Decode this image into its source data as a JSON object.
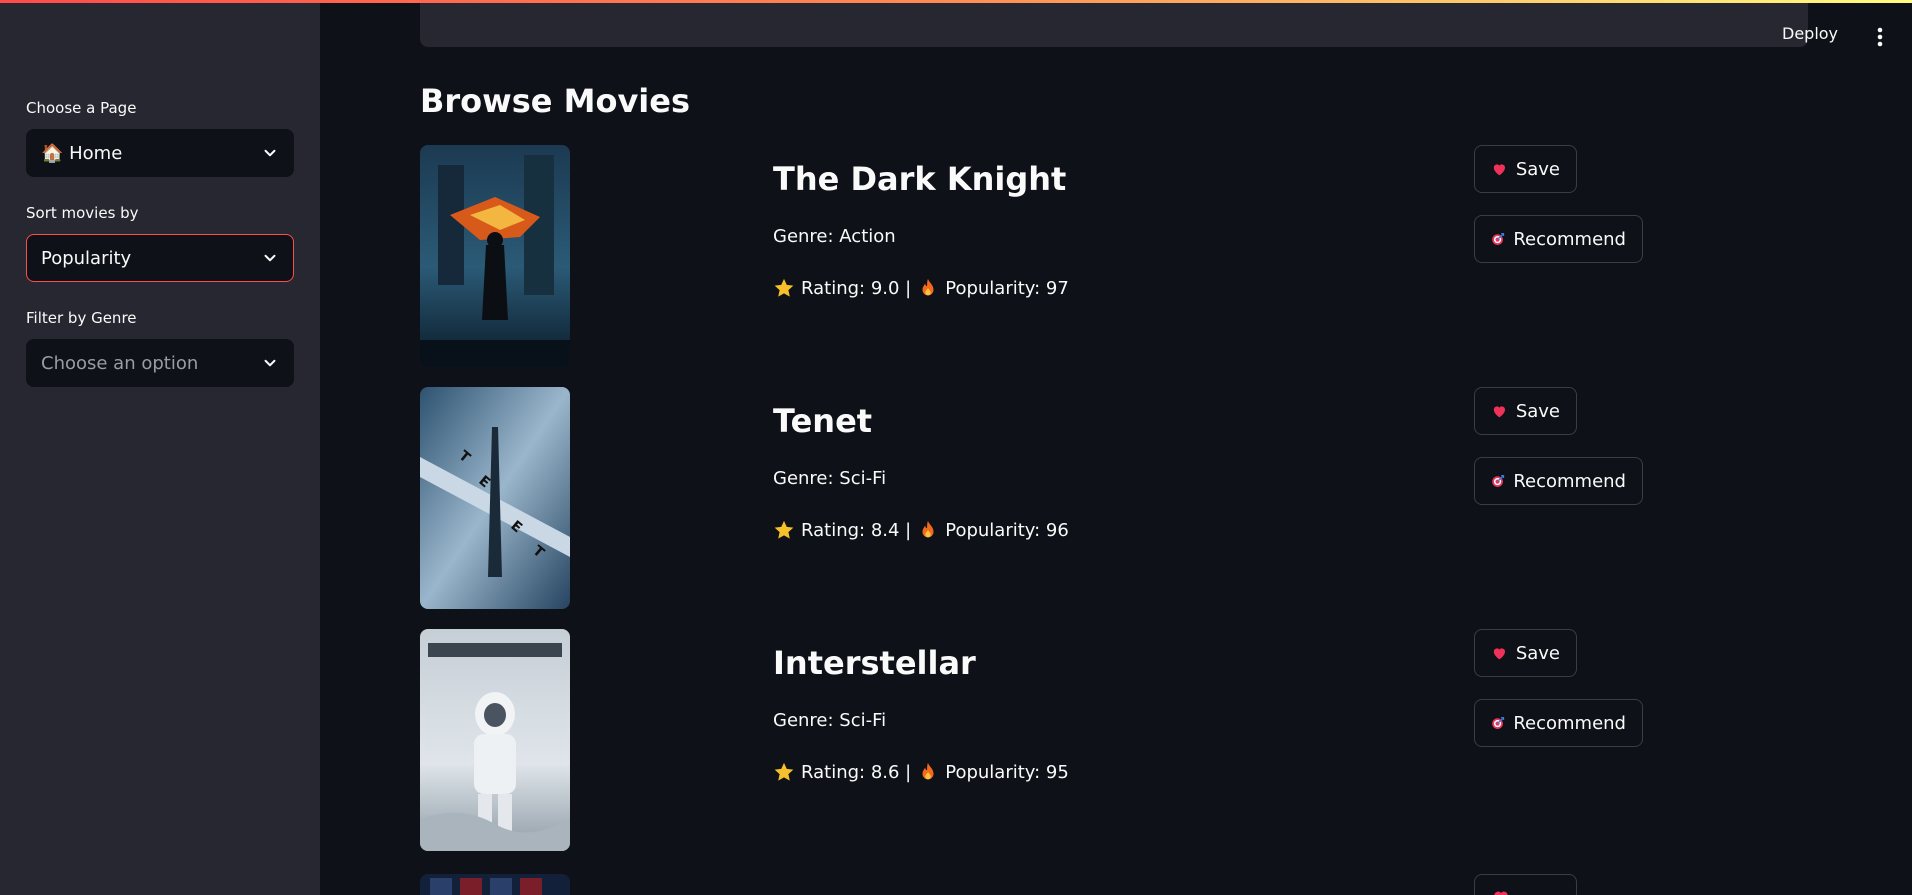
{
  "header": {
    "deploy_label": "Deploy"
  },
  "sidebar": {
    "page_label": "Choose a Page",
    "page_value": "🏠 Home",
    "sort_label": "Sort movies by",
    "sort_value": "Popularity",
    "genre_label": "Filter by Genre",
    "genre_placeholder": "Choose an option"
  },
  "main": {
    "title": "Browse Movies",
    "save_label": "Save",
    "recommend_label": "Recommend",
    "movies": [
      {
        "title": "The Dark Knight",
        "genre": "Genre: Action",
        "rating": "Rating: 9.0 |",
        "popularity": "Popularity: 97"
      },
      {
        "title": "Tenet",
        "genre": "Genre: Sci-Fi",
        "rating": "Rating: 8.4 |",
        "popularity": "Popularity: 96"
      },
      {
        "title": "Interstellar",
        "genre": "Genre: Sci-Fi",
        "rating": "Rating: 8.6 |",
        "popularity": "Popularity: 95"
      }
    ]
  },
  "colors": {
    "accent": "#ff4b4b",
    "sidebar_bg": "#262730",
    "main_bg": "#0e1117"
  }
}
